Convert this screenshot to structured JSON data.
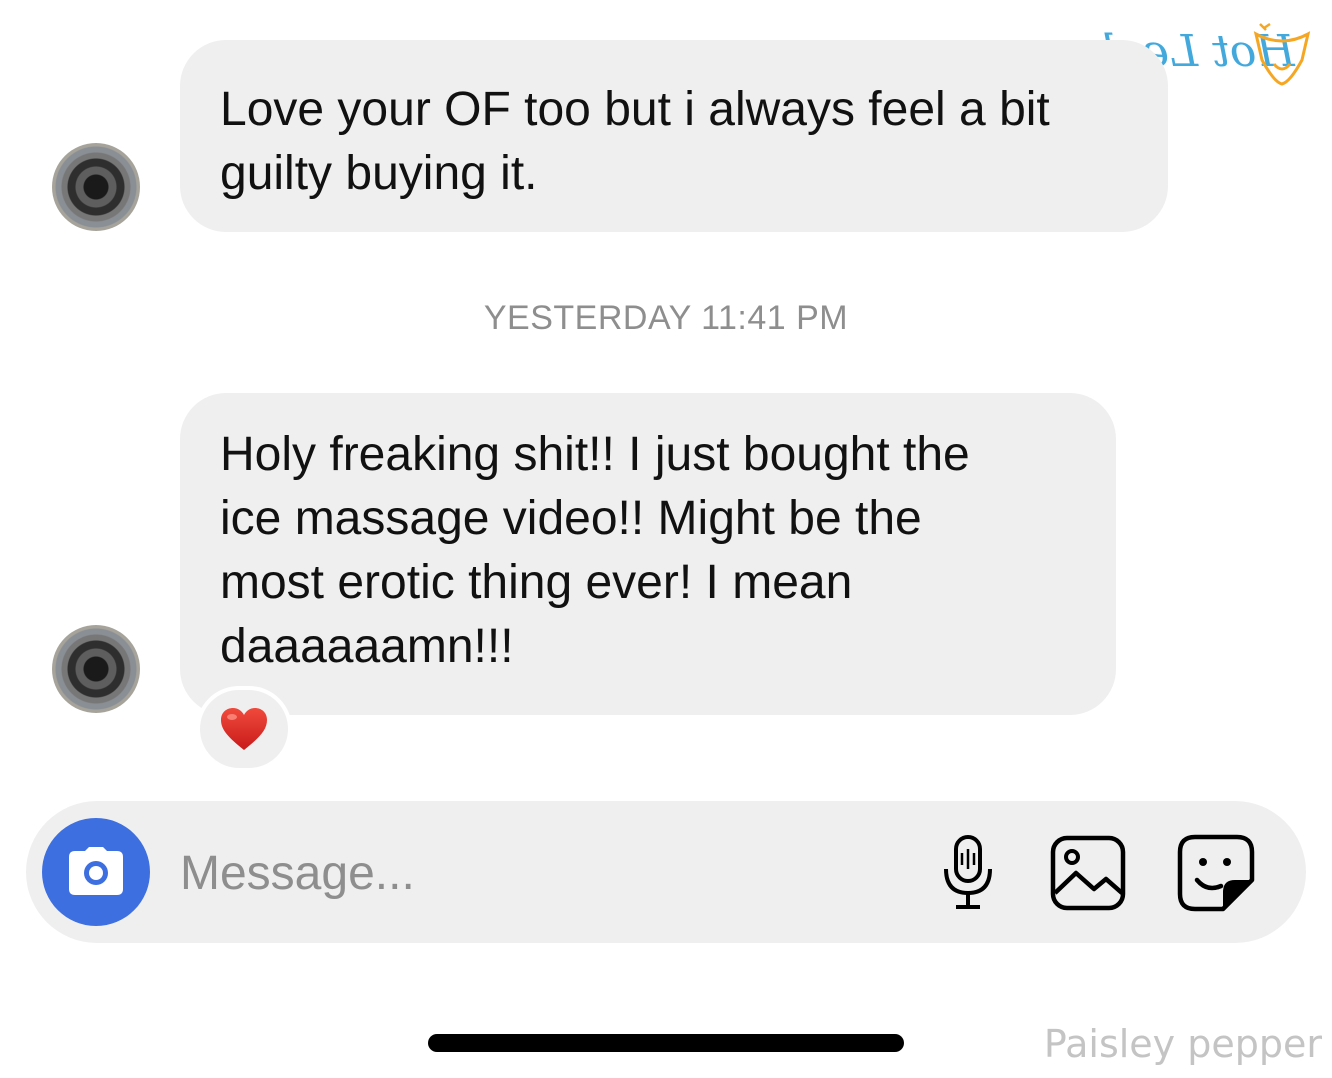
{
  "watermark": {
    "text": "Hot Leak",
    "color": "#43a9dd",
    "accent_color": "#f5a623"
  },
  "messages": [
    {
      "text": "Love your OF too but i always feel a bit\nguilty buying it."
    },
    {
      "text": "Holy freaking shit!!  I just bought the\nice massage video!!  Might be the\nmost erotic thing ever!  I mean\ndaaaaaamn!!!",
      "reaction": "heart-emoji"
    }
  ],
  "timestamp": "YESTERDAY 11:41 PM",
  "composer": {
    "placeholder": "Message...",
    "camera_icon": "camera-icon",
    "icons": [
      "microphone-icon",
      "gallery-icon",
      "sticker-icon"
    ],
    "accent_color": "#3d6fe0"
  },
  "credit": "Paisley pepper"
}
